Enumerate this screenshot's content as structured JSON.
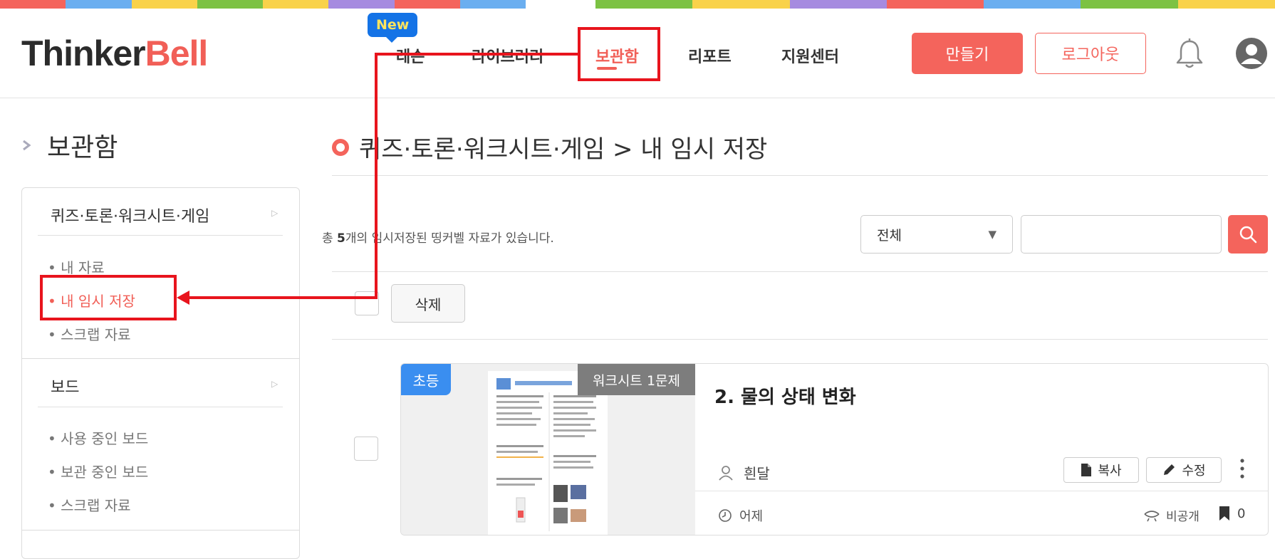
{
  "brand": {
    "logo_part1": "Thinker",
    "logo_part2": "Bell",
    "dark_color": "#2b2b2b",
    "accent_color": "#f15f57"
  },
  "nav": {
    "new_badge": "New",
    "items": [
      {
        "label": "레슨"
      },
      {
        "label": "라이브러리"
      },
      {
        "label": "보관함",
        "active": true
      },
      {
        "label": "리포트"
      },
      {
        "label": "지원센터"
      }
    ]
  },
  "header_actions": {
    "make_label": "만들기",
    "logout_label": "로그아웃",
    "bell_icon": "bell-icon",
    "avatar_icon": "user-avatar-icon"
  },
  "sidebar": {
    "title": "보관함",
    "sections": [
      {
        "label": "퀴즈·토론·워크시트·게임",
        "items": [
          "• 내 자료",
          "• 내 임시 저장",
          "• 스크랩 자료"
        ]
      },
      {
        "label": "보드",
        "items": [
          "• 사용 중인 보드",
          "• 보관 중인 보드",
          "• 스크랩 자료"
        ]
      }
    ]
  },
  "main": {
    "title": "퀴즈·토론·워크시트·게임 > 내 임시 저장",
    "count_prefix": "총 ",
    "count": "5",
    "count_suffix": "개의 임시저장된 띵커벨 자료가 있습니다.",
    "filter_selected": "전체",
    "search_placeholder": "",
    "delete_label": "삭제"
  },
  "card": {
    "level_badge": "초등",
    "type_badge": "워크시트 1문제",
    "title": "2. 물의 상태 변화",
    "author": "흰달",
    "copy_label": "복사",
    "edit_label": "수정",
    "time": "어제",
    "privacy": "비공개",
    "bookmarks": "0"
  },
  "colors": {
    "level_badge": "#3a8ef0",
    "type_badge": "#7d7d7d",
    "annotation": "#e8141d"
  }
}
